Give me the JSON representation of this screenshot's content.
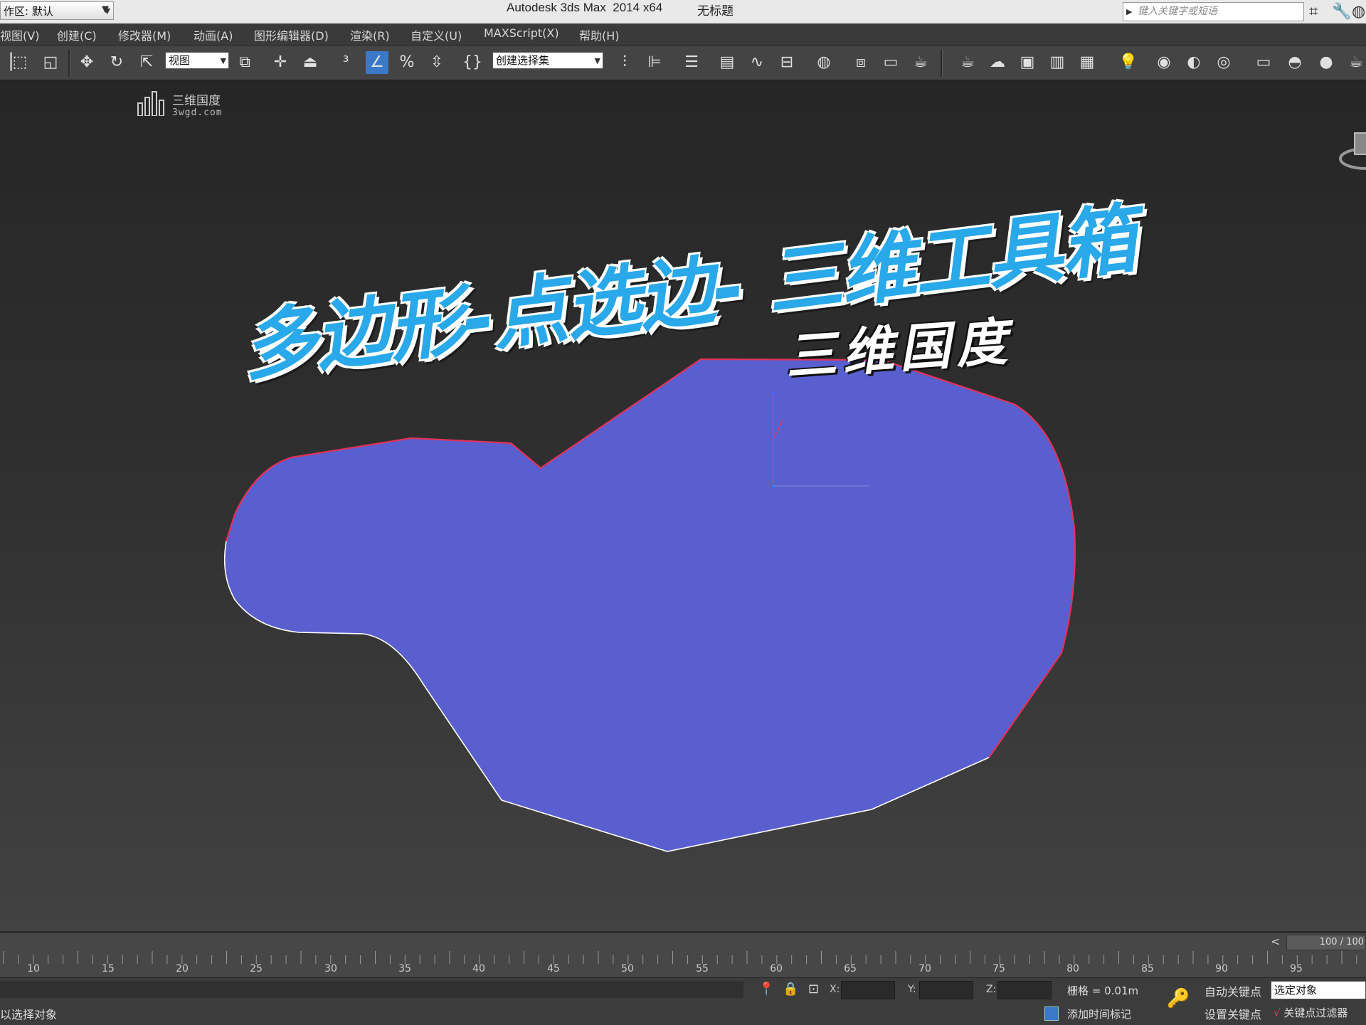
{
  "titlebar": {
    "workspace": "作区: 默认",
    "app_title": "Autodesk 3ds Max  2014 x64",
    "document": "无标题",
    "search_placeholder": "键入关键字或短语"
  },
  "menu": {
    "items": [
      "视图(V)",
      "创建(C)",
      "修改器(M)",
      "动画(A)",
      "图形编辑器(D)",
      "渲染(R)",
      "自定义(U)",
      "MAXScript(X)",
      "帮助(H)"
    ]
  },
  "toolbar": {
    "reference_coord": "视图",
    "named_selection": "创建选择集"
  },
  "viewport": {
    "logo_text": "三维国度",
    "logo_url": "3wgd.com",
    "main_title": "多边形-点选边- 三维工具箱",
    "subtitle": "三维国度",
    "shape_fill": "#5a5fcf",
    "shape_edge_selected": "#e0325a",
    "shape_edge_normal": "#ffffff"
  },
  "timeline": {
    "frame_display": "100 / 100",
    "prev_arrow": "<",
    "tick_labels": [
      "10",
      "15",
      "20",
      "25",
      "30",
      "35",
      "40",
      "45",
      "50",
      "55",
      "60",
      "65",
      "70",
      "75",
      "80",
      "85",
      "90",
      "95"
    ]
  },
  "statusbar": {
    "prompt": "以选择对象",
    "x_label": "X:",
    "y_label": "Y:",
    "z_label": "Z:",
    "grid": "栅格 = 0.01m",
    "add_time_tag": "添加时间标记",
    "auto_key": "自动关键点",
    "set_key": "设置关键点",
    "key_target": "选定对象",
    "key_filters": "关键点过滤器"
  }
}
